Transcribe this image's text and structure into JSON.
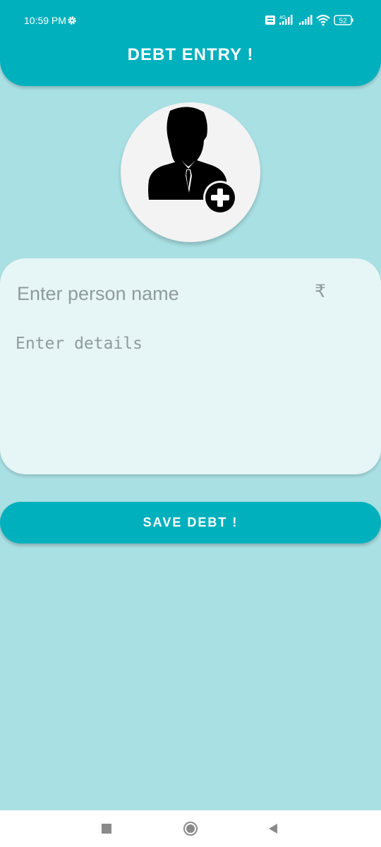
{
  "status_bar": {
    "time": "10:59 PM",
    "battery": "52"
  },
  "header": {
    "title": "DEBT ENTRY !"
  },
  "avatar": {
    "icon": "add-person-icon"
  },
  "form": {
    "name_placeholder": "Enter person name",
    "name_value": "",
    "currency_symbol": "₹",
    "details_placeholder": "Enter details",
    "details_value": ""
  },
  "actions": {
    "save_label": "SAVE DEBT !"
  },
  "colors": {
    "accent": "#00b0bd",
    "background": "#a9e0e4",
    "card": "#e6f5f6",
    "placeholder": "#8f9b9c"
  },
  "nav": {
    "recent_icon": "square-icon",
    "home_icon": "circle-icon",
    "back_icon": "triangle-back-icon"
  }
}
